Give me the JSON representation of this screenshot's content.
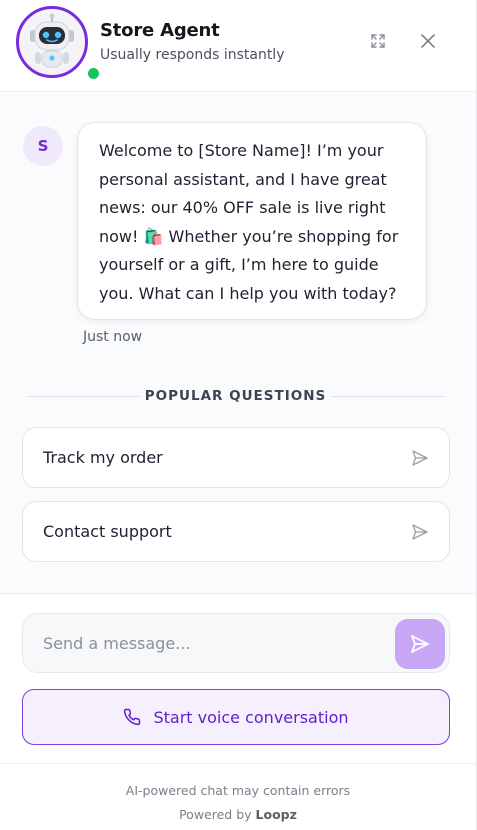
{
  "header": {
    "agent_name": "Store Agent",
    "agent_status": "Usually responds instantly",
    "online_color": "#16c45c",
    "avatar_border_color": "#7a2be0",
    "expand_icon": "expand-icon",
    "close_icon": "close-icon"
  },
  "conversation": {
    "bot_initial": "S",
    "messages": [
      {
        "sender": "bot",
        "text": "Welcome to [Store Name]! I’m your personal assistant, and I have great news: our 40% OFF sale is live right now! 🛍️ Whether you’re shopping for yourself or a gift, I’m here to guide you. What can I help you with today?",
        "timestamp": "Just now"
      }
    ]
  },
  "popular_questions": {
    "title": "POPULAR QUESTIONS",
    "items": [
      {
        "label": "Track my order"
      },
      {
        "label": "Contact support"
      }
    ]
  },
  "composer": {
    "placeholder": "Send a message...",
    "value": "",
    "send_icon": "send-icon",
    "send_color": "#c7a6f5"
  },
  "voice": {
    "label": "Start voice conversation",
    "icon": "phone-icon",
    "accent": "#5f22c9"
  },
  "footer": {
    "disclaimer": "AI-powered chat may contain errors",
    "powered_prefix": "Powered by ",
    "brand": "Loopz"
  }
}
